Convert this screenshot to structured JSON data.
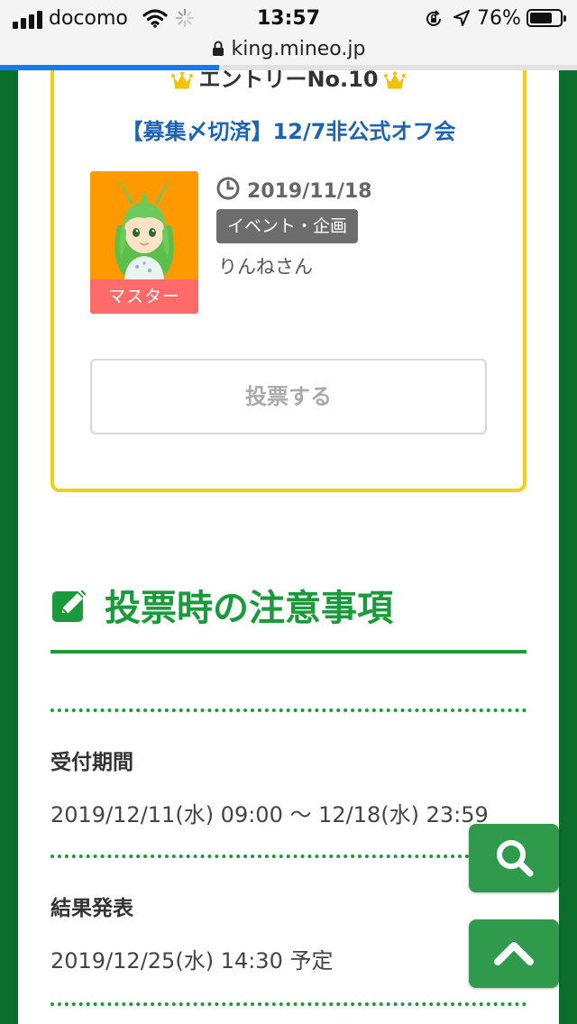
{
  "status_bar": {
    "carrier": "docomo",
    "time": "13:57",
    "battery_percent": "76%",
    "battery_level": 0.76,
    "icons": [
      "signal-icon",
      "wifi-icon",
      "activity-spinner-icon",
      "rotation-lock-icon",
      "location-icon",
      "battery-icon"
    ]
  },
  "browser": {
    "url": "king.mineo.jp",
    "load_progress": 0.38
  },
  "entry": {
    "heading": "エントリーNo.10",
    "title": "【募集〆切済】12/7非公式オフ会",
    "date": "2019/11/18",
    "category": "イベント・企画",
    "author": "りんねさん",
    "role_badge": "マスター",
    "vote_label": "投票する"
  },
  "notes": {
    "heading": "投票時の注意事項",
    "items": [
      {
        "label": "受付期間",
        "value": "2019/12/11(水) 09:00 ～ 12/18(水) 23:59"
      },
      {
        "label": "結果発表",
        "value": "2019/12/25(水) 14:30 予定"
      }
    ]
  },
  "colors": {
    "frame_green": "#0b6e2a",
    "accent_green": "#1a9a3a",
    "card_border": "#f4cf11",
    "title_blue": "#1b64b5",
    "badge_red": "#ff6b6b",
    "avatar_bg": "#ff9900",
    "fab_green": "#2f9a4c"
  },
  "floating_buttons": {
    "search_icon": "search-icon",
    "top_icon": "chevron-up-icon"
  }
}
